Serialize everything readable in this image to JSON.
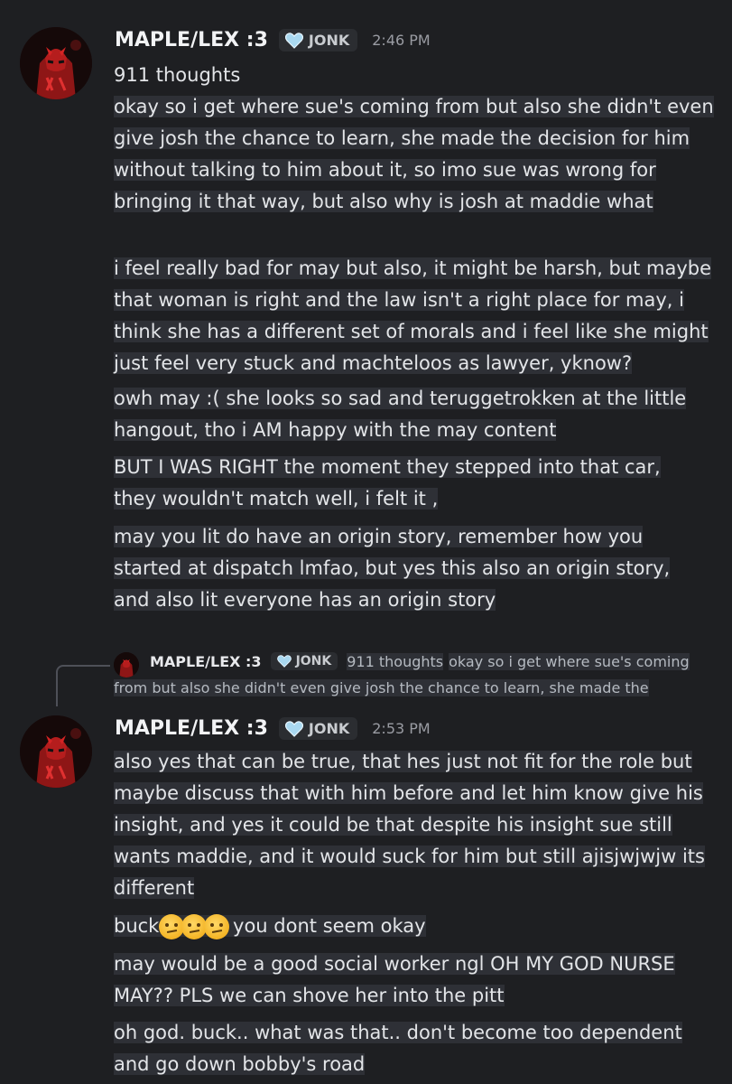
{
  "messages": [
    {
      "username": "MAPLE/LEX :3",
      "tag": "JONK",
      "time": "2:46 PM",
      "lines": [
        "911 thoughts",
        " okay so i get where sue's coming from but also she didn't even",
        "give josh the chance to learn, she made the decision for him",
        "without talking to him about it, so imo sue was wrong for",
        "bringing it that way, but also why is josh at maddie what",
        "",
        " i feel really bad for may but also, it might be harsh, but maybe",
        "that woman is right and the law isn't a right place for may, i",
        "think she has a different set of morals and i feel like she might",
        "just feel very stuck and machteloos as lawyer, yknow?",
        " owh may :( she looks so sad and teruggetrokken at the little",
        "hangout, tho i AM happy with the may content",
        " BUT I WAS RIGHT the moment they stepped into that car,",
        "they wouldn't match well, i felt it ,",
        " may you lit do have an origin story, remember how you",
        "started at dispatch lmfao, but yes this also an origin story,",
        "and also lit everyone has an origin story"
      ]
    },
    {
      "username": "MAPLE/LEX :3",
      "tag": "JONK",
      "time": "2:53 PM",
      "lines": [
        "also  yes that can be true, that hes just not fit for the role but",
        "maybe discuss that with him before and let him know give his",
        "insight, and yes it could be that despite his insight sue still",
        "wants maddie, and it would suck for him but still ajisjwjwjw its",
        "different",
        " buck",
        " you dont seem okay",
        " may would be a good social worker ngl OH MY GOD NURSE",
        "MAY?? PLS we can shove her into the pitt",
        " oh god. buck.. what was that.. don't become too dependent",
        "and go down bobby's road"
      ]
    }
  ],
  "reply": {
    "username": "MAPLE/LEX :3",
    "tag": "JONK",
    "title": "911 thoughts",
    "preview_start": "okay so i get where sue's coming",
    "preview_cont": "from but also she didn't even give josh the chance to learn, she made the"
  },
  "colors": {
    "background": "#1e1f22",
    "highlight": "#2e3036",
    "username": "#f2f3f5",
    "tag_bg": "#2b2d31"
  },
  "icons": [
    "daredevil-avatar",
    "heart-icon",
    "face-with-raised-eyebrow-emoji"
  ]
}
